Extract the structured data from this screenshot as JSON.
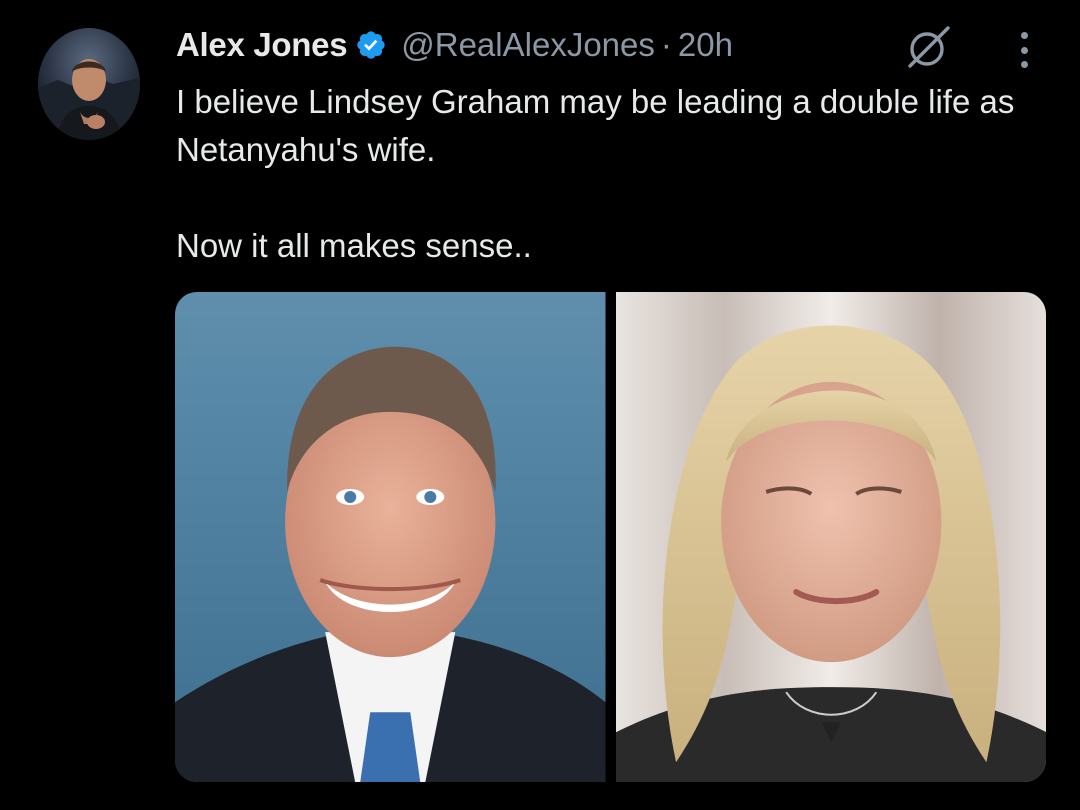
{
  "author": {
    "display_name": "Alex Jones",
    "handle": "@RealAlexJones",
    "separator": "·",
    "time": "20h",
    "verified": true,
    "verified_color": "#1d9bf0"
  },
  "tweet": {
    "paragraphs": [
      "I believe Lindsey Graham may be leading a double life as Netanyahu's wife.",
      "Now it all makes sense.."
    ]
  },
  "icons": {
    "verified": "verified-badge-icon",
    "grok": "grok-icon",
    "more": "more-options-icon"
  },
  "media": {
    "count": 2
  },
  "colors": {
    "background": "#000000",
    "text": "#e7e9ea",
    "secondary_text": "#8b98a5",
    "accent": "#1d9bf0"
  }
}
